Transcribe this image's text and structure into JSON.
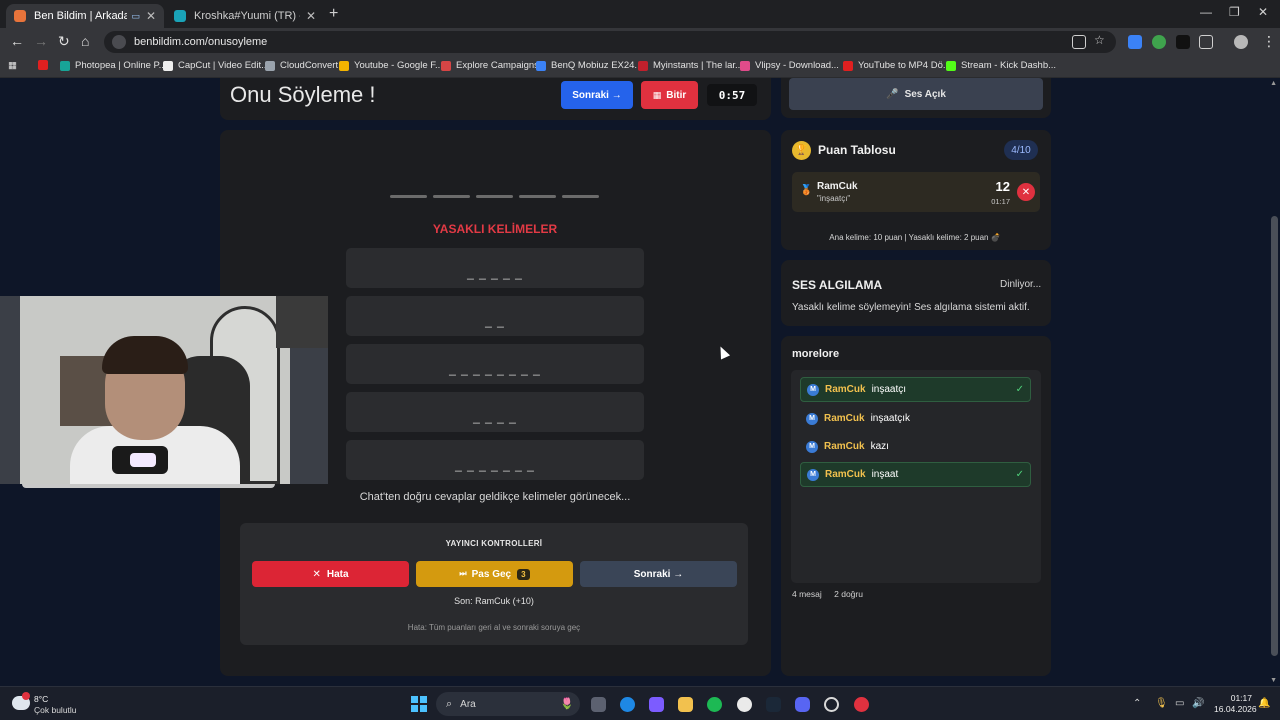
{
  "browser": {
    "tabs": [
      {
        "title": "Ben Bildim | Arkadaşlarınla",
        "active": true
      },
      {
        "title": "Kroshka#Yuumi (TR) - LeagueO",
        "active": false
      }
    ],
    "url": "benbildim.com/onusoyleme",
    "bookmarks": [
      "Photopea | Online P...",
      "CapCut | Video Edit...",
      "CloudConvert",
      "Youtube - Google F...",
      "Explore Campaigns",
      "BenQ Mobiuz EX24...",
      "Myinstants | The lar...",
      "Vlipsy - Download...",
      "YouTube to MP4 Dö...",
      "Stream - Kick Dashb..."
    ]
  },
  "game": {
    "title": "Onu Söyleme !",
    "next_label": "Sonraki →",
    "finish_label": "Bitir",
    "timer": "0:57",
    "banned_title": "YASAKLI KELİMELER",
    "banned_words": [
      "_ _ _ _ _",
      "_ _",
      "_ _ _ _ _ _ _ _",
      "_ _ _ _",
      "_ _ _ _ _ _ _"
    ],
    "hint": "Chat'ten doğru cevaplar geldikçe kelimeler görünecek...",
    "controls": {
      "title": "YAYINCI KONTROLLERİ",
      "error_label": "Hata",
      "skip_label": "Pas Geç",
      "skip_count": "3",
      "next_label": "Sonraki →",
      "last": "Son: RamCuk (+10)",
      "note": "Hata: Tüm puanları geri al ve sonraki soruya geç"
    }
  },
  "sidebar": {
    "sound_label": "Ses Açık",
    "scoreboard": {
      "title": "Puan Tablosu",
      "count": "4/10",
      "rows": [
        {
          "name": "RamCuk",
          "word": "\"inşaatçı\"",
          "points": "12",
          "time": "01:17"
        }
      ],
      "rule": "Ana kelime: 10 puan | Yasaklı kelime: 2 puan 💣"
    },
    "voice": {
      "title": "SES ALGILAMA",
      "status": "Dinliyor...",
      "description": "Yasaklı kelime söylemeyin! Ses algılama sistemi aktif."
    },
    "chat": {
      "channel": "morelore",
      "messages": [
        {
          "user": "RamCuk",
          "text": "inşaatçı",
          "correct": true
        },
        {
          "user": "RamCuk",
          "text": "inşaatçık",
          "correct": false
        },
        {
          "user": "RamCuk",
          "text": "kazı",
          "correct": false
        },
        {
          "user": "RamCuk",
          "text": "inşaat",
          "correct": true
        }
      ],
      "messages_count": "4 mesaj",
      "correct_count": "2 doğru"
    }
  },
  "taskbar": {
    "temperature": "8°C",
    "condition": "Çok bulutlu",
    "search_placeholder": "Ara",
    "time": "01:17",
    "date": "16.04.2026"
  },
  "colors": {
    "primary_blue": "#2563eb",
    "danger_red": "#e0313f",
    "warning_gold": "#d49a0f",
    "accent_green": "#4fd17a"
  }
}
